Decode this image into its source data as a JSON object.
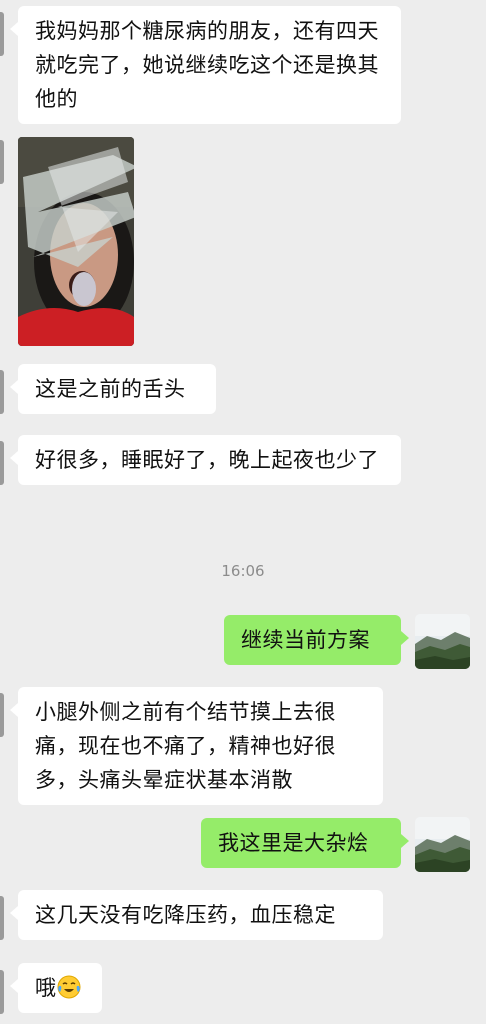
{
  "messages": [
    {
      "side": "in",
      "text": "我妈妈那个糖尿病的朋友，还有四天就吃完了，她说继续吃这个还是换其他的"
    },
    {
      "side": "in",
      "type": "image",
      "icon": "photo"
    },
    {
      "side": "in",
      "text": "这是之前的舌头"
    },
    {
      "side": "in",
      "text": "好很多，睡眠好了，晚上起夜也少了"
    },
    {
      "side": "out",
      "text": "继续当前方案"
    },
    {
      "side": "in",
      "text": "小腿外侧之前有个结节摸上去很痛，现在也不痛了，精神也好很多，头痛头晕症状基本消散"
    },
    {
      "side": "out",
      "text": "我这里是大杂烩"
    },
    {
      "side": "in",
      "text": "这几天没有吃降压药，血压稳定"
    },
    {
      "side": "in",
      "text": "哦",
      "emoji": "crying-laughing-emoji"
    }
  ],
  "timestamp": "16:06",
  "colors": {
    "background": "#ededed",
    "incoming_bubble": "#ffffff",
    "outgoing_bubble": "#95ec69",
    "timestamp_text": "#8c8c8c"
  }
}
